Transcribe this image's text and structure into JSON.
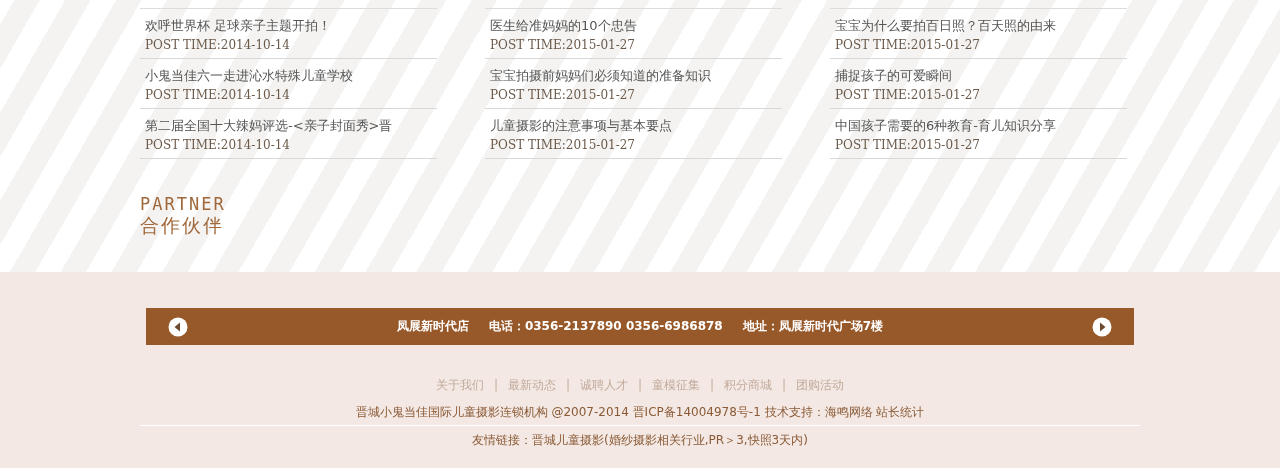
{
  "news_columns": [
    {
      "items": [
        {
          "title": "欢呼世界杯 足球亲子主题开拍！",
          "post_time": "POST TIME:2014-10-14"
        },
        {
          "title": "小鬼当佳六一走进沁水特殊儿童学校",
          "post_time": "POST TIME:2014-10-14"
        },
        {
          "title": "第二届全国十大辣妈评选-<亲子封面秀>晋",
          "post_time": "POST TIME:2014-10-14"
        }
      ]
    },
    {
      "items": [
        {
          "title": "医生给准妈妈的10个忠告",
          "post_time": "POST TIME:2015-01-27"
        },
        {
          "title": "宝宝拍摄前妈妈们必须知道的准备知识",
          "post_time": "POST TIME:2015-01-27"
        },
        {
          "title": "儿童摄影的注意事项与基本要点",
          "post_time": "POST TIME:2015-01-27"
        }
      ]
    },
    {
      "items": [
        {
          "title": "宝宝为什么要拍百日照？百天照的由来",
          "post_time": "POST TIME:2015-01-27"
        },
        {
          "title": "捕捉孩子的可爱瞬间",
          "post_time": "POST TIME:2015-01-27"
        },
        {
          "title": "中国孩子需要的6种教育-育儿知识分享",
          "post_time": "POST TIME:2015-01-27"
        }
      ]
    }
  ],
  "partner": {
    "title_en": "PARTNER",
    "title_cn": "合作伙伴"
  },
  "store_bar": {
    "store": "凤展新时代店",
    "phone": "电话：0356-2137890 0356-6986878",
    "address": "地址：凤展新时代广场7楼"
  },
  "footer_links": [
    "关于我们",
    "最新动态",
    "诚聘人才",
    "童模征集",
    "积分商城",
    "团购活动"
  ],
  "footer_separator": "|",
  "copyright": "晋城小鬼当佳国际儿童摄影连锁机构 @2007-2014 晋ICP备14004978号-1 技术支持：海鸣网络 站长统计",
  "friend_links": {
    "label": "友情链接：",
    "link": "晋城儿童摄影",
    "note": "(婚纱摄影相关行业,PR＞3,快照3天内)"
  }
}
